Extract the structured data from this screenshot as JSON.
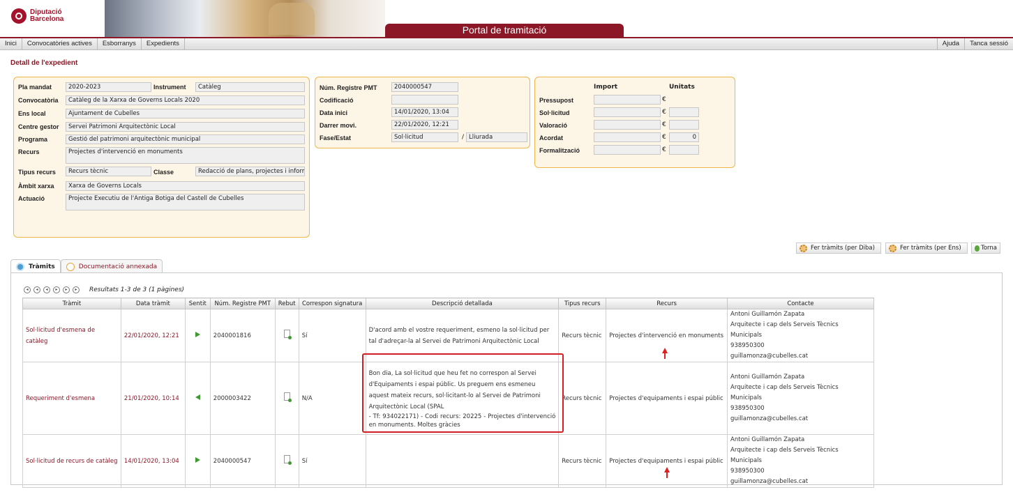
{
  "header": {
    "logo_line1": "Diputació",
    "logo_line2": "Barcelona",
    "portal_title": "Portal de tramitació"
  },
  "nav": {
    "items": [
      "Inici",
      "Convocatòries actives",
      "Esborranys",
      "Expedients"
    ],
    "right_items": [
      "Ajuda",
      "Tanca sessió"
    ]
  },
  "page_title": "Detall de l'expedient",
  "detail": {
    "pla_mandat": {
      "label": "Pla mandat",
      "value": "2020-2023"
    },
    "instrument": {
      "label": "Instrument",
      "value": "Catàleg"
    },
    "convocatoria": {
      "label": "Convocatòria",
      "value": "Catàleg de la Xarxa de Governs Locals 2020"
    },
    "ens_local": {
      "label": "Ens local",
      "value": "Ajuntament de Cubelles"
    },
    "centre_gestor": {
      "label": "Centre gestor",
      "value": "Servei Patrimoni Arquitectònic Local"
    },
    "programa": {
      "label": "Programa",
      "value": "Gestió del patrimoni arquitectònic municipal"
    },
    "recurs": {
      "label": "Recurs",
      "value": "Projectes d'intervenció en monuments"
    },
    "tipus_recurs": {
      "label": "Tipus recurs",
      "value": "Recurs tècnic"
    },
    "classe": {
      "label": "Classe",
      "value": "Redacció de plans, projectes i inform"
    },
    "ambit_xarxa": {
      "label": "Àmbit xarxa",
      "value": "Xarxa de Governs Locals"
    },
    "actuacio": {
      "label": "Actuació",
      "value": "Projecte Executiu de l'Antiga Botiga del Castell de Cubelles"
    }
  },
  "registry": {
    "num_registre": {
      "label": "Núm. Registre PMT",
      "value": "2040000547"
    },
    "codificacio": {
      "label": "Codificació",
      "value": ""
    },
    "data_inici": {
      "label": "Data inici",
      "value": "14/01/2020, 13:04"
    },
    "darrer_movi": {
      "label": "Darrer movi.",
      "value": "22/01/2020, 12:21"
    },
    "fase_estat": {
      "label": "Fase/Estat",
      "fase": "Sol·licitud",
      "separator": "/",
      "estat": "Lliurada"
    }
  },
  "amounts": {
    "col_import": "Import",
    "col_unitats": "Unitats",
    "currency": "€",
    "rows": [
      {
        "label": "Pressupost",
        "import": "",
        "unitats": null
      },
      {
        "label": "Sol·licitud",
        "import": "",
        "unitats": ""
      },
      {
        "label": "Valoració",
        "import": "",
        "unitats": ""
      },
      {
        "label": "Acordat",
        "import": "",
        "unitats": "0"
      },
      {
        "label": "Formalització",
        "import": "",
        "unitats": ""
      }
    ]
  },
  "actions": {
    "fer_tramits_diba": "Fer tràmits (per Diba)",
    "fer_tramits_ens": "Fer tràmits (per Ens)",
    "torna": "Torna"
  },
  "tabs": {
    "tramits": "Tràmits",
    "documentacio": "Documentació annexada"
  },
  "pager": {
    "text": "Resultats 1-3 de 3 (1 pàgines)"
  },
  "table": {
    "headers": [
      "Tràmit",
      "Data tràmit",
      "Sentit",
      "Núm. Registre PMT",
      "Rebut",
      "Correspon signatura",
      "Descripció detallada",
      "Tipus recurs",
      "Recurs",
      "Contacte"
    ],
    "rows": [
      {
        "tramit": "Sol·licitud d'esmena de catàleg",
        "data": "22/01/2020, 12:21",
        "sentit": "out",
        "registre": "2040001816",
        "signatura": "Sí",
        "descripcio": "D'acord amb el vostre requeriment, esmeno la sol·licitud per tal d'adreçar-la al Servei de Patrimoni Arquitectònic Local",
        "tipus": "Recurs tècnic",
        "recurs": "Projectes d'intervenció en monuments",
        "contacte": [
          "Antoni Guillamón Zapata",
          "Arquitecte i cap dels Serveis Tècnics Municipals",
          "938950300",
          "guillamonza@cubelles.cat"
        ]
      },
      {
        "tramit": "Requeriment d'esmena",
        "data": "21/01/2020, 10:14",
        "sentit": "in",
        "registre": "2000003422",
        "signatura": "N/A",
        "descripcio": "Bon dia, La sol·licitud que heu fet no correspon al Servei d'Equipaments i espai públic. Us preguem ens esmeneu aquest mateix recurs, sol·licitant-lo al Servei de Patrimoni Arquitectònic Local (SPAL",
        "descripcio2": "- Tf: 934022171) - Codi recurs: 20225 - Projectes d'intervenció en monuments. Moltes gràcies",
        "tipus": "Recurs tècnic",
        "recurs": "Projectes d'equipaments i espai públic",
        "contacte": [
          "Antoni Guillamón Zapata",
          "Arquitecte i cap dels Serveis Tècnics Municipals",
          "938950300",
          "guillamonza@cubelles.cat"
        ]
      },
      {
        "tramit": "Sol·licitud de recurs de catàleg",
        "data": "14/01/2020, 13:04",
        "sentit": "out",
        "registre": "2040000547",
        "signatura": "Sí",
        "descripcio": "",
        "tipus": "Recurs tècnic",
        "recurs": "Projectes d'equipaments i espai públic",
        "contacte": [
          "Antoni Guillamón Zapata",
          "Arquitecte i cap dels Serveis Tècnics Municipals",
          "938950300",
          "guillamonza@cubelles.cat"
        ]
      }
    ]
  },
  "colors": {
    "brand": "#8b1727",
    "panel_border": "#f0b64a",
    "highlight": "#d21d24",
    "arrow_green": "#3d9a2e"
  }
}
